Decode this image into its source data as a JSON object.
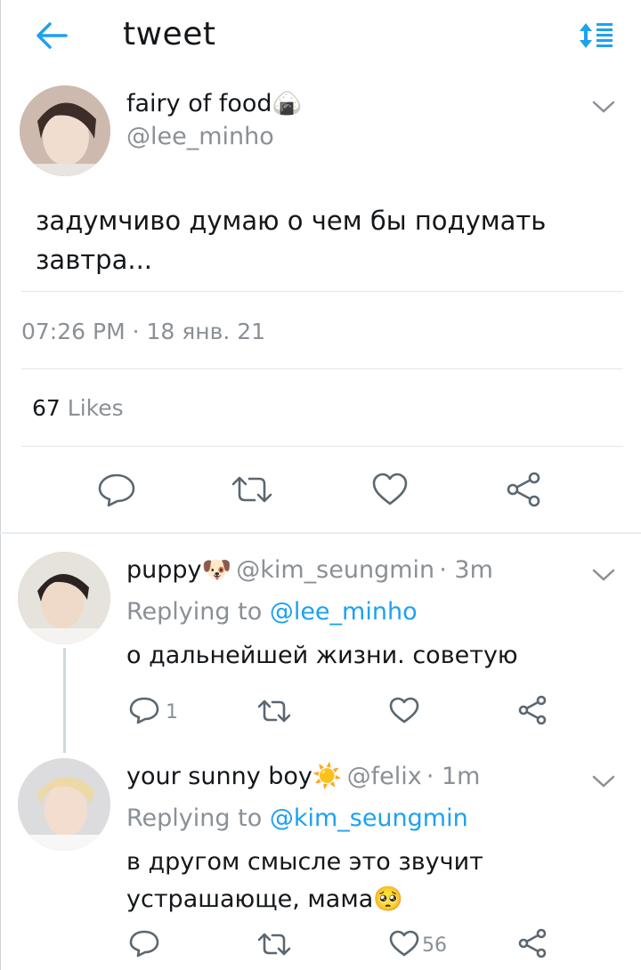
{
  "header": {
    "title": "tweet"
  },
  "tweet": {
    "name": "fairy of food",
    "name_emoji": "🍙",
    "handle": "@lee_minho",
    "text": "задумчиво думаю о чем бы подумать завтра...",
    "timestamp": "07:26 PM · 18 янв. 21",
    "likes_count": "67",
    "likes_label": "Likes"
  },
  "replies": [
    {
      "name": "puppy",
      "name_emoji": "🐶",
      "handle": "@kim_seungmin",
      "time": "· 3m",
      "replying_prefix": "Replying to",
      "replying_to": "@lee_minho",
      "text": "о дальнейшей жизни. советую",
      "reply_count": "1",
      "like_count": ""
    },
    {
      "name": "your sunny boy",
      "name_emoji": "☀️",
      "handle": "@felix",
      "time": "· 1m",
      "replying_prefix": "Replying to",
      "replying_to": "@kim_seungmin",
      "text": "в другом смысле это звучит устрашающе, мама🥺",
      "reply_count": "",
      "like_count": "56"
    }
  ],
  "colors": {
    "accent": "#1da1f2",
    "text": "#14171a",
    "muted": "#8a9096"
  }
}
